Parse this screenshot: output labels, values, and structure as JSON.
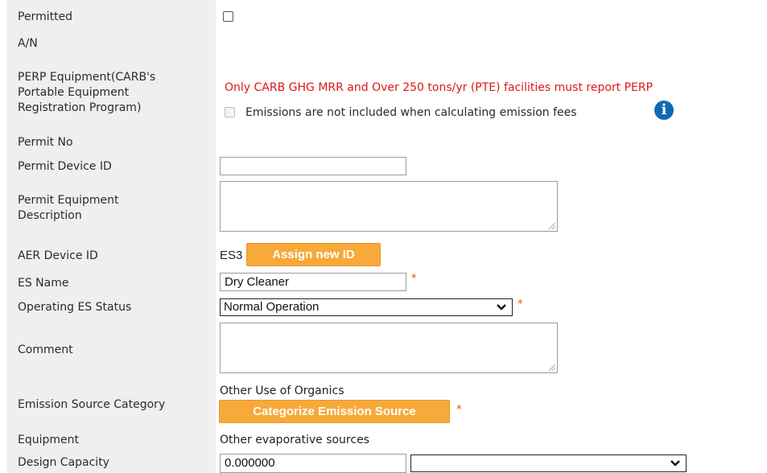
{
  "labels": {
    "permitted": "Permitted",
    "an": "A/N",
    "perp_line1": "PERP Equipment(CARB's",
    "perp_line2": "Portable Equipment",
    "perp_line3": "Registration Program)",
    "permit_no": "Permit No",
    "permit_device_id": "Permit Device ID",
    "permit_eq_desc_line1": "Permit Equipment",
    "permit_eq_desc_line2": "Description",
    "aer_device_id": "AER Device ID",
    "es_name": "ES Name",
    "operating_es_status": "Operating ES Status",
    "comment": "Comment",
    "emission_source_category": "Emission Source Category",
    "equipment": "Equipment",
    "design_capacity": "Design Capacity"
  },
  "fields": {
    "permitted_checked": false,
    "perp_warning": "Only CARB GHG MRR and Over 250 tons/yr (PTE) facilities must report PERP",
    "perp_checkbox_label": "Emissions are not included when calculating emission fees",
    "permit_device_id_value": "",
    "permit_eq_desc_value": "",
    "aer_device_id_value": "ES3",
    "assign_new_id_label": "Assign new ID",
    "es_name_value": "Dry Cleaner",
    "operating_status_value": "Normal Operation",
    "comment_value": "",
    "emission_source_category_value": "Other Use of Organics",
    "categorize_button_label": "Categorize Emission Source",
    "equipment_value": "Other evaporative sources",
    "design_capacity_value": "0.000000",
    "design_capacity_unit_value": "",
    "required_mark": "*",
    "info_glyph": "i"
  },
  "colors": {
    "label_bg": "#efefef",
    "warning_text": "#e01616",
    "button_orange": "#f7a93a",
    "info_blue": "#1069b4",
    "required_star": "#e04a1a"
  },
  "icons": {
    "info": "info-circle-icon",
    "dropdown": "chevron-down-icon",
    "resize": "resize-grip-icon"
  }
}
